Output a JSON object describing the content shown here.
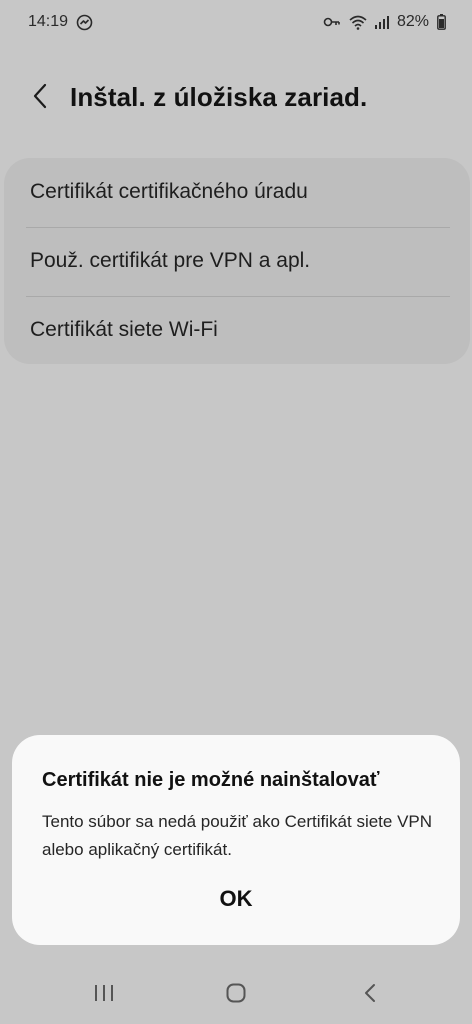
{
  "status_bar": {
    "time": "14:19",
    "battery_percent": "82%",
    "icons": [
      "messenger-icon",
      "vpn-key-icon",
      "wifi-icon",
      "signal-icon",
      "battery-icon"
    ]
  },
  "header": {
    "title": "Inštal. z úložiska zariad.",
    "back_icon": "back-chevron-icon"
  },
  "settings": {
    "items": [
      {
        "label": "Certifikát certifikačného úradu"
      },
      {
        "label": "Použ. certifikát pre VPN a apl."
      },
      {
        "label": "Certifikát siete Wi-Fi"
      }
    ]
  },
  "dialog": {
    "title": "Certifikát nie je možné nainštalovať",
    "message": "Tento súbor sa nedá použiť ako Certifikát siete VPN alebo aplikačný certifikát.",
    "ok_label": "OK"
  },
  "navigation": {
    "icons": [
      "recent-apps-icon",
      "home-icon",
      "back-icon"
    ]
  },
  "colors": {
    "background": "#c7c7c7",
    "card": "#bebebe",
    "dialog": "#f9f9f9",
    "text": "#111111"
  }
}
